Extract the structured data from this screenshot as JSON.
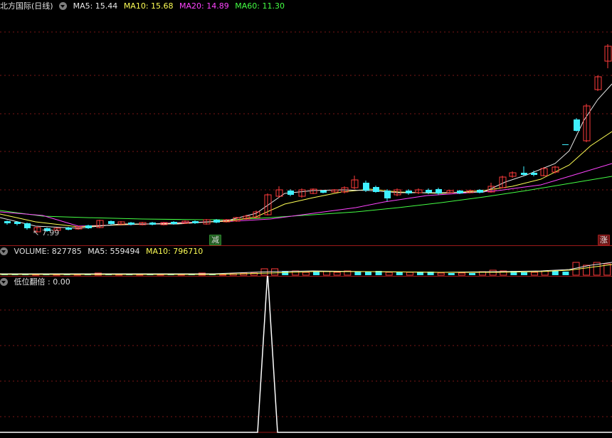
{
  "main": {
    "title": "北方国际(日线)",
    "ma5": "MA5: 15.44",
    "ma10": "MA10: 15.68",
    "ma20": "MA20: 14.89",
    "ma60": "MA60: 11.30",
    "low_label": "7.99",
    "tag_left": "减",
    "tag_right": "涨"
  },
  "volume": {
    "label": "VOLUME: 827785",
    "ma5": "MA5: 559494",
    "ma10": "MA10: 796710"
  },
  "indicator": {
    "label": "低位翻倍  : 0.00"
  },
  "colors": {
    "up": "#ff3b3b",
    "down": "#3ff0ff",
    "ma5": "#e8e8e8",
    "ma10": "#ffff55",
    "ma20": "#ff44ff",
    "ma60": "#44ff44",
    "grid": "#9b1a1a"
  }
}
